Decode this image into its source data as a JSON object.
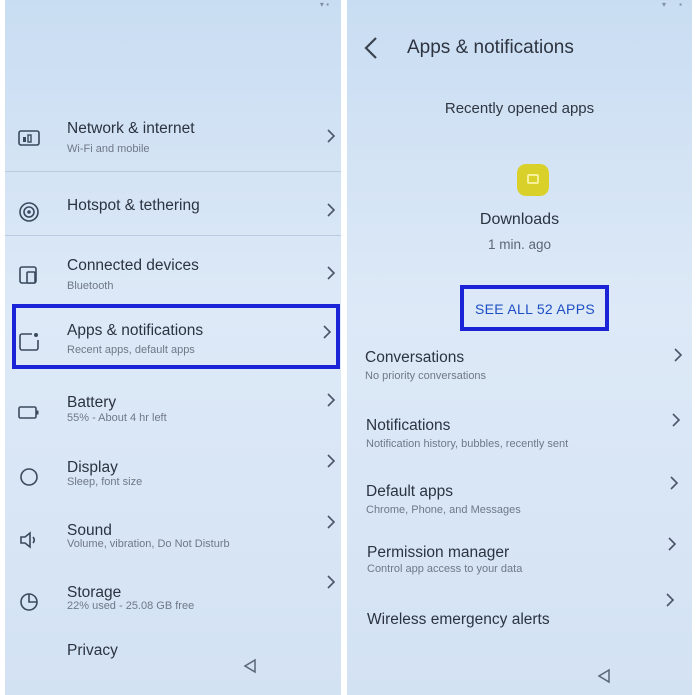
{
  "left_screen": {
    "settings_items": [
      {
        "title": "Network & internet",
        "subtitle": "Wi-Fi and mobile",
        "icon": "network-icon"
      },
      {
        "title": "Hotspot & tethering",
        "subtitle": "",
        "icon": "hotspot-icon"
      },
      {
        "title": "Connected devices",
        "subtitle": "Bluetooth",
        "icon": "connected-devices-icon"
      },
      {
        "title": "Apps & notifications",
        "subtitle": "Recent apps, default apps",
        "icon": "apps-icon"
      },
      {
        "title": "Battery",
        "subtitle": "55% - About 4 hr left",
        "icon": "battery-icon"
      },
      {
        "title": "Display",
        "subtitle": "Sleep, font size",
        "icon": "display-icon"
      },
      {
        "title": "Sound",
        "subtitle": "Volume, vibration, Do Not Disturb",
        "icon": "sound-icon"
      },
      {
        "title": "Storage",
        "subtitle": "22% used - 25.08 GB free",
        "icon": "storage-icon"
      },
      {
        "title": "Privacy",
        "subtitle": "",
        "icon": "privacy-icon"
      }
    ],
    "highlighted_item": "Apps & notifications"
  },
  "right_screen": {
    "title": "Apps & notifications",
    "recent_section_title": "Recently opened apps",
    "recent_app": {
      "name": "Downloads",
      "time": "1 min. ago",
      "icon": "downloads-app-icon",
      "icon_color": "#d9d12a"
    },
    "see_all_label": "SEE ALL 52 APPS",
    "items": [
      {
        "title": "Conversations",
        "subtitle": "No priority conversations"
      },
      {
        "title": "Notifications",
        "subtitle": "Notification history, bubbles, recently sent"
      },
      {
        "title": "Default apps",
        "subtitle": "Chrome, Phone, and Messages"
      },
      {
        "title": "Permission manager",
        "subtitle": "Control app access to your data"
      },
      {
        "title": "Wireless emergency alerts",
        "subtitle": ""
      }
    ]
  },
  "colors": {
    "highlight_border": "#1a24d6",
    "link_blue": "#1d4fc4",
    "screen_bg": "#d6e4f4"
  }
}
